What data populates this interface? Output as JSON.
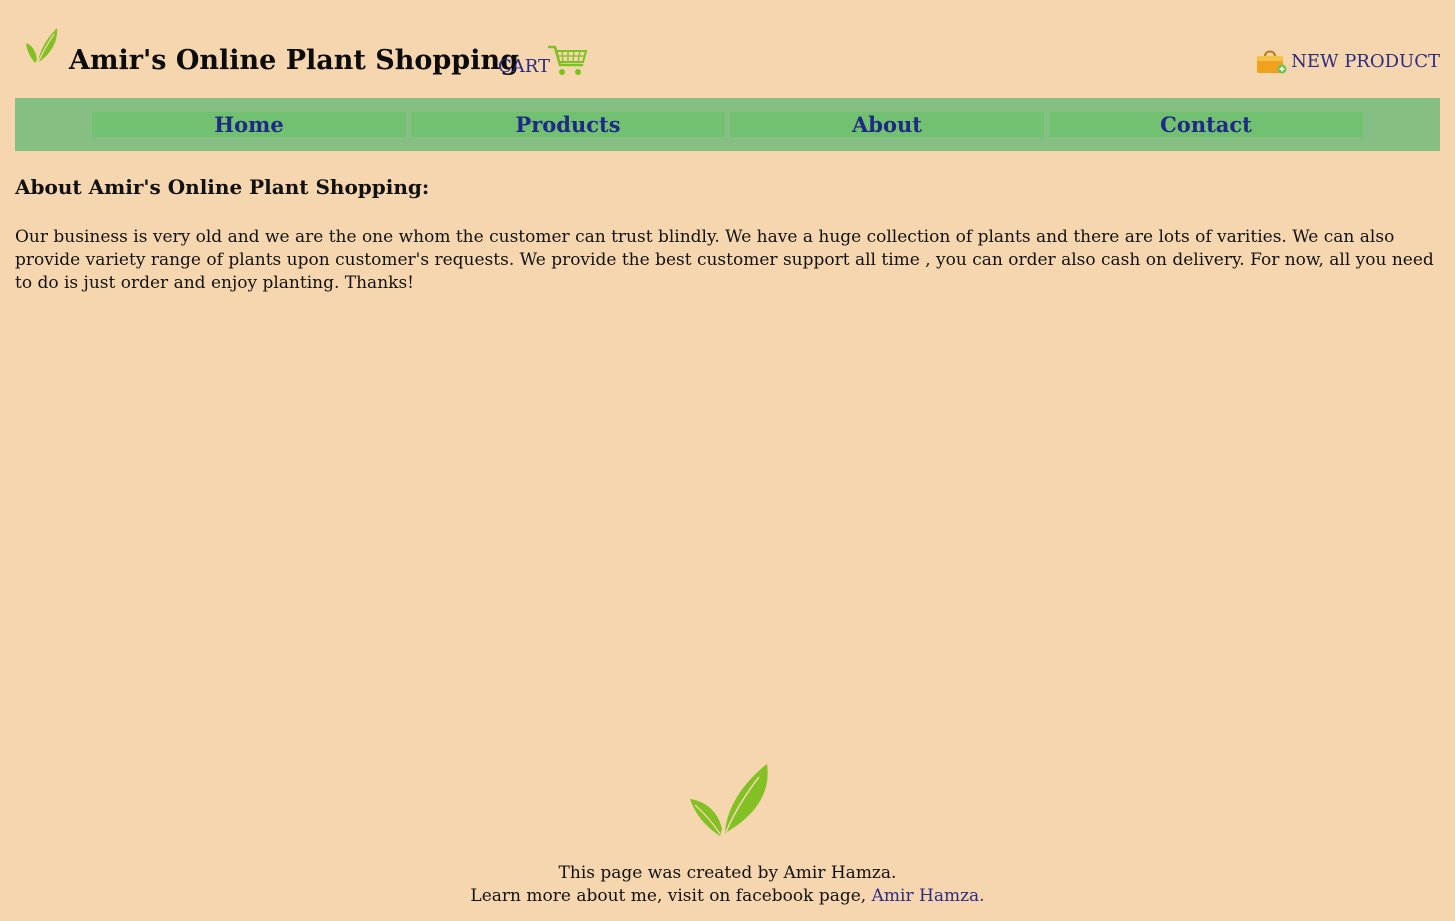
{
  "header": {
    "site_title": "Amir's Online Plant Shopping",
    "cart_label": "CART",
    "new_product_label": "NEW PRODUCT"
  },
  "nav": {
    "items": [
      {
        "label": "Home"
      },
      {
        "label": "Products"
      },
      {
        "label": "About"
      },
      {
        "label": "Contact"
      }
    ]
  },
  "main": {
    "heading": "About Amir's Online Plant Shopping:",
    "paragraph": "Our business is very old and we are the one whom the customer can trust blindly. We have a huge collection of plants and there are lots of varities. We can also provide variety range of plants upon customer's requests. We provide the best customer support all time , you can order also cash on delivery. For now, all you need to do is just order and enjoy planting. Thanks!"
  },
  "footer": {
    "created_by": "This page was created by Amir Hamza.",
    "learn_more": "Learn more about me, visit on facebook page,",
    "link_text": "Amir Hamza."
  },
  "colors": {
    "background": "#f6d6ae",
    "nav_bar": "#86bf84",
    "nav_item": "#71c170",
    "nav_text": "#1e2a86",
    "link": "#2b2a85",
    "leaf_green": "#82c024"
  },
  "icons": {
    "logo": "leaf-icon",
    "cart": "shopping-cart-icon",
    "new_product": "shopping-bag-icon",
    "footer_logo": "leaf-icon"
  }
}
